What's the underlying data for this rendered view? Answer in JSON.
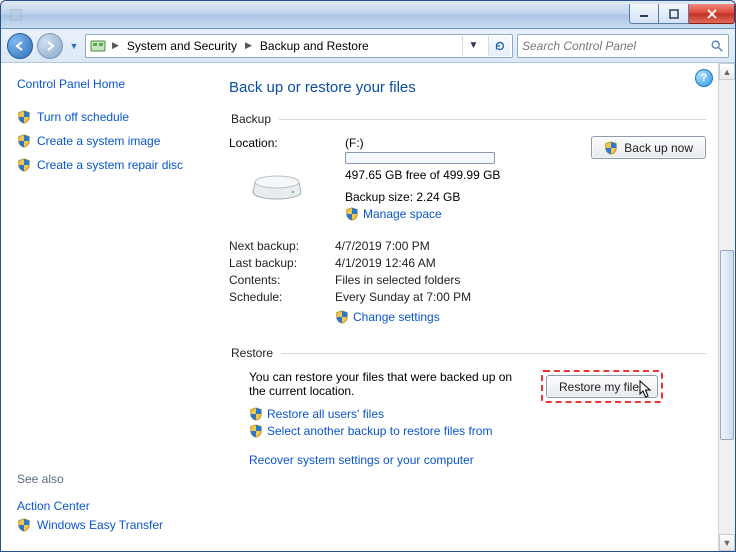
{
  "breadcrumb": {
    "seg1": "System and Security",
    "seg2": "Backup and Restore"
  },
  "searchbox": {
    "placeholder": "Search Control Panel"
  },
  "sidebar": {
    "home": "Control Panel Home",
    "items": [
      "Turn off schedule",
      "Create a system image",
      "Create a system repair disc"
    ],
    "seealso_label": "See also",
    "seealso": [
      "Action Center",
      "Windows Easy Transfer"
    ]
  },
  "page": {
    "title": "Back up or restore your files",
    "backup_legend": "Backup",
    "restore_legend": "Restore",
    "location_label": "Location:",
    "location_value": "(F:)",
    "free_text": "497.65 GB free of 499.99 GB",
    "backup_size": "Backup size: 2.24 GB",
    "manage_space": "Manage space",
    "backup_now": "Back up now",
    "rows": {
      "next_label": "Next backup:",
      "next_val": "4/7/2019 7:00 PM",
      "last_label": "Last backup:",
      "last_val": "4/1/2019 12:46 AM",
      "contents_label": "Contents:",
      "contents_val": "Files in selected folders",
      "schedule_label": "Schedule:",
      "schedule_val": "Every Sunday at 7:00 PM"
    },
    "change_settings": "Change settings",
    "restore_desc": "You can restore your files that were backed up on the current location.",
    "restore_my_files": "Restore my files",
    "restore_all": "Restore all users' files",
    "select_another": "Select another backup to restore files from",
    "recover_link": "Recover system settings or your computer"
  }
}
